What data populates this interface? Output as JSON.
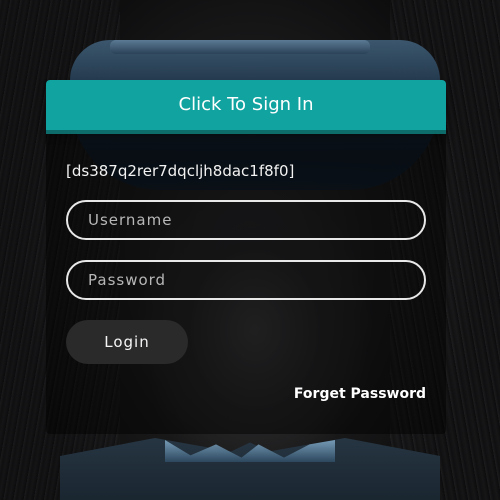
{
  "header": {
    "sign_in_label": "Click To Sign In"
  },
  "form": {
    "token": "[ds387q2rer7dqcljh8dac1f8f0]",
    "username_placeholder": "Username",
    "password_placeholder": "Password",
    "login_label": "Login",
    "forgot_label": "Forget Password"
  },
  "colors": {
    "accent": "#11a3a0",
    "button_bg": "#2a2a2b",
    "field_border": "#e8e8e8"
  }
}
